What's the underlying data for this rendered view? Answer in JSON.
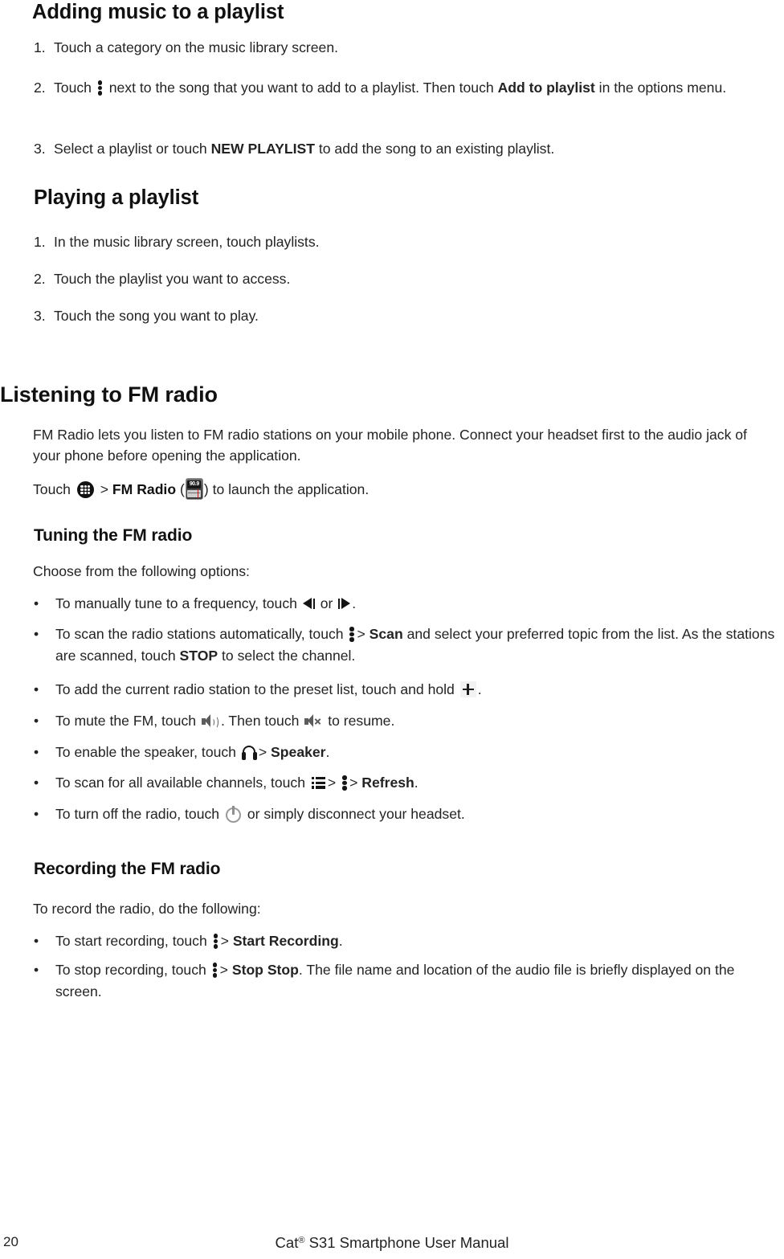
{
  "document": {
    "page_number": "20",
    "footer_title_prefix": "Cat",
    "footer_title_registered": "®",
    "footer_title_suffix": " S31 Smartphone User Manual"
  },
  "sections": {
    "adding_music": {
      "heading": "Adding music to a playlist",
      "step1_num": "1.",
      "step1_text": "Touch a category on the music library screen.",
      "step2_num": "2.",
      "step2_a": "Touch",
      "step2_b": "next to the song that you want to add to a playlist. Then touch",
      "step2_bold": "Add to playlist",
      "step2_c": "in the options menu.",
      "step3_num": "3.",
      "step3_a": "Select a playlist or touch",
      "step3_bold": "NEW PLAYLIST",
      "step3_b": "to add the song to an existing playlist."
    },
    "playing_playlist": {
      "heading": "Playing a playlist",
      "step1_num": "1.",
      "step1_text": "In the music library screen, touch playlists.",
      "step2_num": "2.",
      "step2_text": "Touch the playlist you want to access.",
      "step3_num": "3.",
      "step3_text": "Touch the song you want to play."
    },
    "listening_fm": {
      "heading": "Listening to FM radio",
      "intro": "FM Radio lets you listen to FM radio stations on your mobile phone. Connect your headset first to the audio jack of your phone before opening the application.",
      "launch_a": "Touch",
      "launch_sep": ">",
      "launch_bold": "FM Radio",
      "launch_open_paren": "(",
      "launch_close_paren": ")",
      "launch_b": "to launch the application.",
      "fm_app_frequency": "90.9",
      "fm_app_unit": "FM"
    },
    "tuning_fm": {
      "heading": "Tuning the FM radio",
      "intro": "Choose from the following options:",
      "bullet_char": "•",
      "items": [
        {
          "a": "To manually tune to a frequency, touch",
          "mid": "or",
          "b": "."
        },
        {
          "a": "To scan the radio stations automatically, touch",
          "sep": ">",
          "bold": "Scan",
          "b": "and select your preferred topic from the list. As the stations are scanned, touch",
          "bold2": "STOP",
          "c": "to select the channel."
        },
        {
          "a": "To add the current radio station to the preset list, touch and hold",
          "b": "."
        },
        {
          "a": "To mute the FM, touch",
          "b": ". Then touch",
          "c": "to resume."
        },
        {
          "a": "To enable the speaker, touch",
          "sep": ">",
          "bold": "Speaker",
          "b": "."
        },
        {
          "a": "To scan for all available channels, touch",
          "sep": ">",
          "sep2": ">",
          "bold": "Refresh",
          "b": "."
        },
        {
          "a": "To turn off the radio, touch",
          "b": "or simply disconnect your headset."
        }
      ]
    },
    "recording_fm": {
      "heading": "Recording the FM radio",
      "intro": "To record the radio, do the following:",
      "bullet_char": "•",
      "items": [
        {
          "a": "To start recording, touch",
          "sep": ">",
          "bold": "Start Recording",
          "b": "."
        },
        {
          "a": "To stop recording, touch",
          "sep": ">",
          "bold": "Stop Stop",
          "b": ". The file name and location of the audio file is briefly displayed on the screen."
        }
      ]
    }
  },
  "icons": {
    "kebab": "overflow-menu-icon",
    "apps": "apps-grid-icon",
    "fm_app": "fm-radio-app-icon",
    "prev": "previous-station-icon",
    "next": "next-station-icon",
    "plus": "add-preset-icon",
    "speaker": "speaker-on-icon",
    "mute": "speaker-mute-icon",
    "headphone": "headphone-icon",
    "list": "channel-list-icon",
    "power": "power-off-icon"
  },
  "colors": {
    "text": "#232323",
    "heading": "#111111",
    "needle": "#d01515"
  }
}
